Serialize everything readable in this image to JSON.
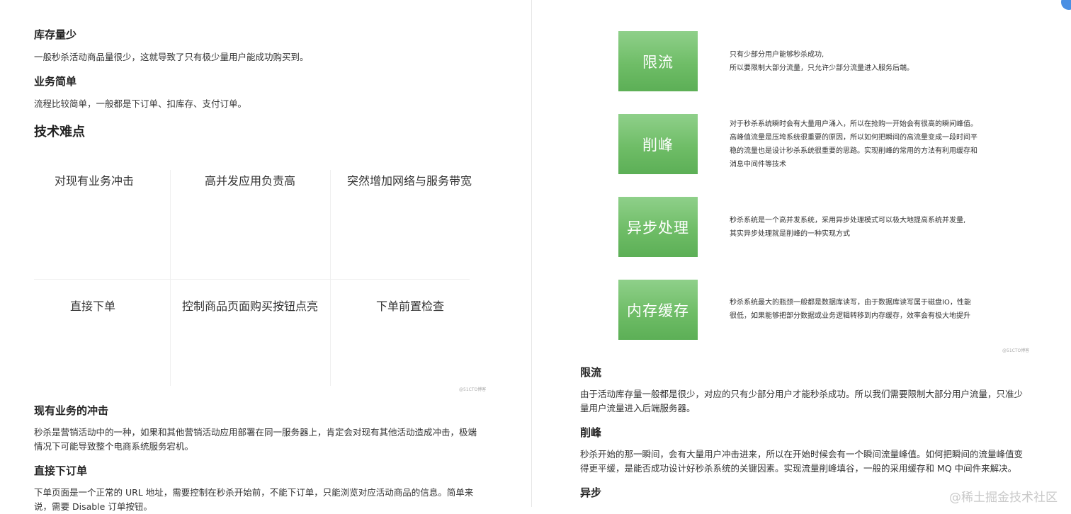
{
  "left": {
    "s1_title": "库存量少",
    "s1_text": "一般秒杀活动商品量很少，这就导致了只有极少量用户能成功购买到。",
    "s2_title": "业务简单",
    "s2_text": "流程比较简单，一般都是下订单、扣库存、支付订单。",
    "s3_title": "技术难点",
    "grid": [
      "对现有业务冲击",
      "高并发应用负责高",
      "突然增加网络与服务带宽",
      "直接下单",
      "控制商品页面购买按钮点亮",
      "下单前置检查"
    ],
    "grid_credit": "@51CTO博客",
    "s4_title": "现有业务的冲击",
    "s4_text_1": "秒杀是营销活动中的一种，如果和其他营销活动应用部署在同一服务器上，肯定会对现有其他活动造成冲击，极端",
    "s4_text_2": "情况下可能导致整个电商系统服务宕机。",
    "s5_title": "直接下订单",
    "s5_text_1": "下单页面是一个正常的 URL 地址，需要控制在秒杀开始前，不能下订单，只能浏览对应活动商品的信息。简单来",
    "s5_text_2": "说，需要 Disable 订单按钮。"
  },
  "right": {
    "boxes": [
      {
        "label": "限流",
        "lines": [
          "只有少部分用户能够秒杀成功,",
          "所以要限制大部分流量，只允许少部分流量进入服务后端。"
        ]
      },
      {
        "label": "削峰",
        "lines": [
          "对于秒杀系统瞬时会有大量用户涌入，所以在抢购一开始会有很高的瞬间峰值。",
          "高峰值流量是压垮系统很重要的原因，所以如何把瞬间的高流量变成一段时间平",
          "稳的流量也是设计秒杀系统很重要的思路。实现削峰的常用的方法有利用缓存和",
          "消息中间件等技术"
        ]
      },
      {
        "label": "异步处理",
        "lines": [
          "秒杀系统是一个高并发系统，采用异步处理模式可以极大地提高系统并发量,",
          "其实异步处理就是削峰的一种实现方式"
        ]
      },
      {
        "label": "内存缓存",
        "lines": [
          "秒杀系统最大的瓶颈一般都是数据库读写，由于数据库读写属于磁盘IO，性能",
          "很低，如果能够把部分数据或业务逻辑转移到内存缓存，效率会有极大地提升"
        ]
      }
    ],
    "credit": "@51CTO博客",
    "r1_title": "限流",
    "r1_text_1": "由于活动库存量一般都是很少，对应的只有少部分用户才能秒杀成功。所以我们需要限制大部分用户流量，只准少",
    "r1_text_2": "量用户流量进入后端服务器。",
    "r2_title": "削峰",
    "r2_text_1": "秒杀开始的那一瞬间，会有大量用户冲击进来，所以在开始时候会有一个瞬间流量峰值。如何把瞬间的流量峰值变",
    "r2_text_2": "得更平缓，是能否成功设计好秒杀系统的关键因素。实现流量削峰填谷，一般的采用缓存和 MQ 中间件来解决。",
    "r3_title": "异步"
  },
  "watermark": "@稀土掘金技术社区"
}
